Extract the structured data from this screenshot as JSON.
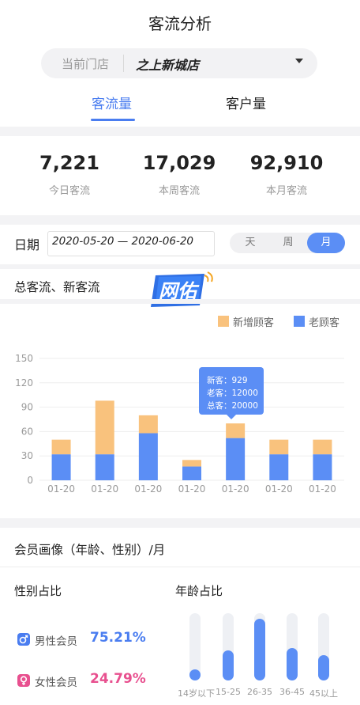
{
  "header": {
    "title": "客流分析"
  },
  "store": {
    "label": "当前门店",
    "name": "之上新城店"
  },
  "tabs": [
    {
      "label": "客流量",
      "active": true
    },
    {
      "label": "客户量",
      "active": false
    }
  ],
  "stats": [
    {
      "value": "7,221",
      "label": "今日客流"
    },
    {
      "value": "17,029",
      "label": "本周客流"
    },
    {
      "value": "92,910",
      "label": "本月客流"
    }
  ],
  "date": {
    "label": "日期",
    "range": "2020-05-20 — 2020-06-20"
  },
  "period": {
    "options": [
      "天",
      "周",
      "月"
    ],
    "selected": "月"
  },
  "chart_section": {
    "title": "总客流、新客流",
    "logo_text": "网佑"
  },
  "chart_data": {
    "type": "bar",
    "stacked": true,
    "categories": [
      "01-20",
      "01-20",
      "01-20",
      "01-20",
      "01-20",
      "01-20",
      "01-20"
    ],
    "series": [
      {
        "name": "老顾客",
        "color": "#5b8ef5",
        "values": [
          32,
          32,
          58,
          17,
          52,
          32,
          32
        ]
      },
      {
        "name": "新增顾客",
        "color": "#f9c27d",
        "values": [
          18,
          66,
          22,
          8,
          18,
          18,
          18
        ]
      }
    ],
    "yticks": [
      "0",
      "30",
      "60",
      "90",
      "120",
      "150"
    ],
    "ylim": [
      0,
      150
    ],
    "grid": true,
    "legend_position": "top-right",
    "tooltip": {
      "lines": [
        "新客：929",
        "老客：12000",
        "总客：20000"
      ]
    }
  },
  "member_section": {
    "title": "会员画像（年龄、性别）/月"
  },
  "gender": {
    "title": "性别占比",
    "items": [
      {
        "label": "男性会员",
        "value": "75.21%",
        "color": "#4a7df0"
      },
      {
        "label": "女性会员",
        "value": "24.79%",
        "color": "#e8508f"
      }
    ]
  },
  "age": {
    "title": "年龄占比",
    "groups": [
      {
        "label": "14岁以下",
        "level": 0.14
      },
      {
        "label": "15-25",
        "level": 0.45
      },
      {
        "label": "26-35",
        "level": 0.92
      },
      {
        "label": "36-45",
        "level": 0.48
      },
      {
        "label": "45以上",
        "level": 0.38
      }
    ]
  }
}
